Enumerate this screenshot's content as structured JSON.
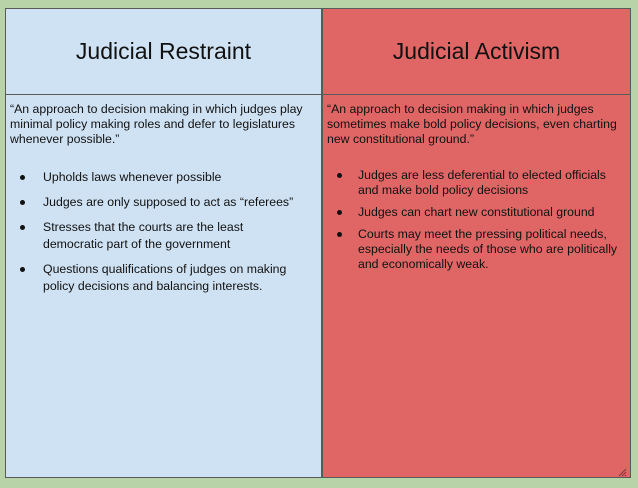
{
  "restraint": {
    "title": "Judicial Restraint",
    "definition": "“An approach to decision making in which judges play minimal policy making roles and defer to legislatures whenever possible.”",
    "points": [
      "Upholds laws whenever possible",
      "Judges are only supposed to act as “referees”",
      "Stresses that the courts are the least democratic part of the government",
      "Questions qualifications of judges on making policy decisions and balancing interests."
    ]
  },
  "activism": {
    "title": "Judicial Activism",
    "definition": "“An approach to decision making in which judges sometimes make bold policy decisions, even charting new constitutional ground.”",
    "points": [
      "Judges are less deferential to elected officials and make bold policy decisions",
      "Judges can chart new constitutional ground",
      "Courts may meet the pressing political needs, especially the needs of those who are politically and economically weak."
    ]
  },
  "colors": {
    "restraint_bg": "#cfe2f3",
    "activism_bg": "#e06666",
    "frame": "#b8d3a8"
  },
  "icons": {
    "resize": "resize-handle-icon"
  }
}
